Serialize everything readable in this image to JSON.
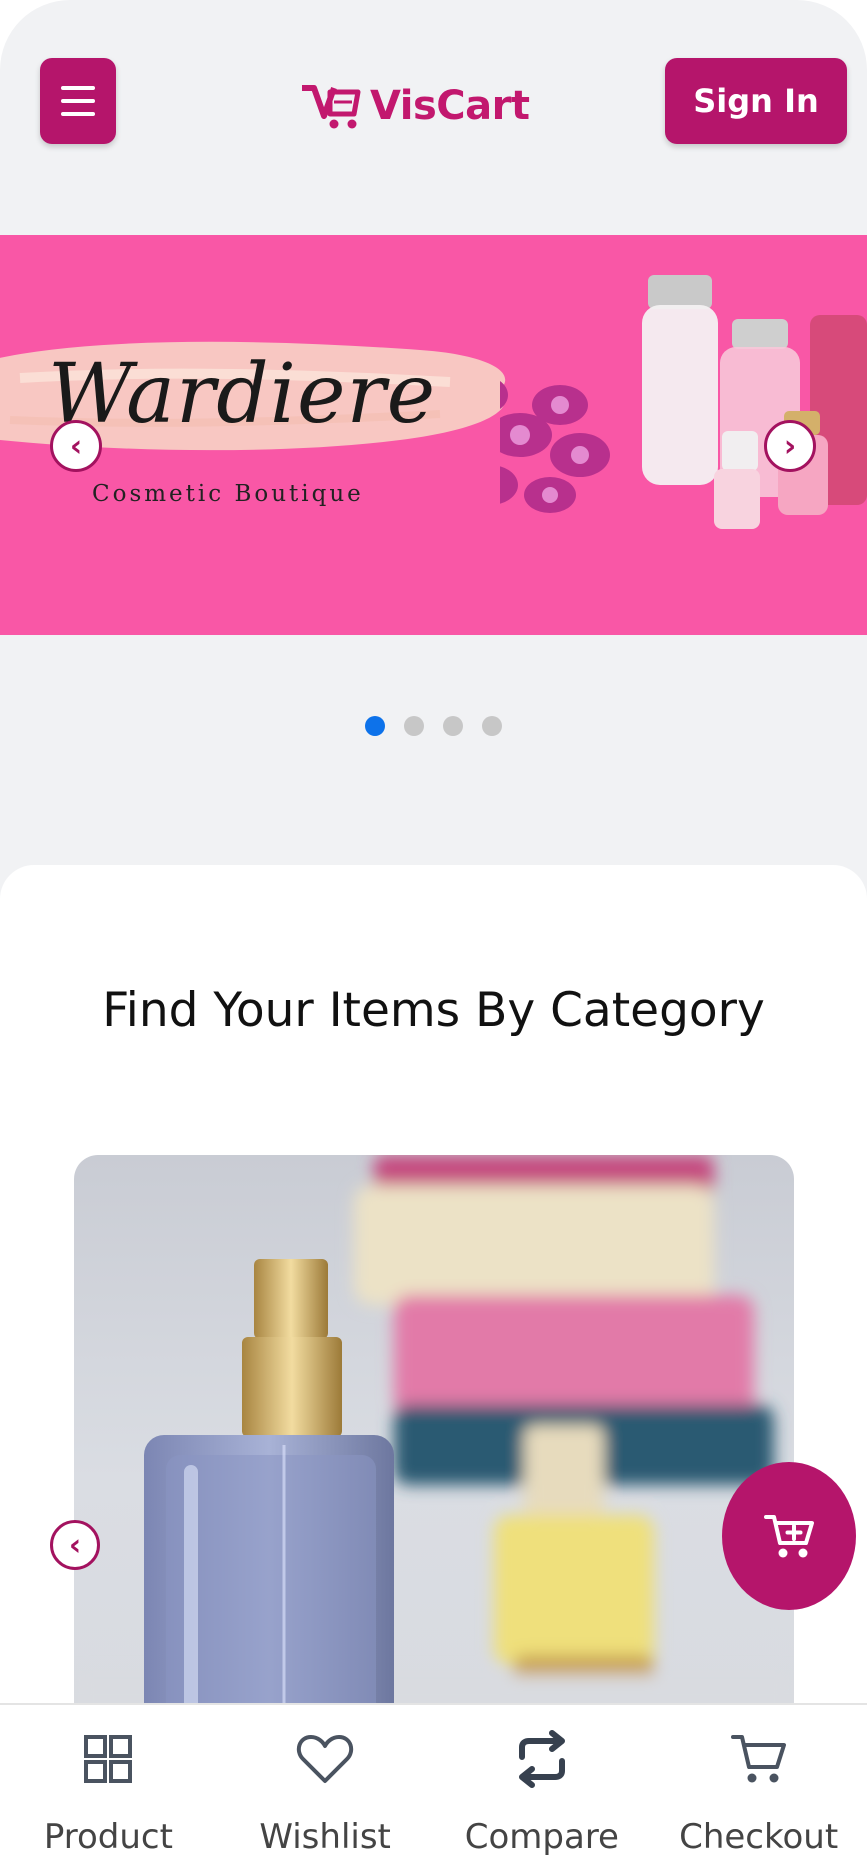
{
  "header": {
    "menu_icon": "hamburger-icon",
    "logo_text": "VisCart",
    "signin_label": "Sign In"
  },
  "banner": {
    "brand_name": "Wardiere",
    "brand_tagline": "Cosmetic Boutique",
    "background_color": "#f957a6",
    "prev_icon": "chevron-left-icon",
    "next_icon": "chevron-right-icon",
    "slide_count": 4,
    "active_slide": 1
  },
  "category": {
    "title": "Find Your Items By Category"
  },
  "fab": {
    "icon": "add-to-cart-icon"
  },
  "bottom_nav": {
    "items": [
      {
        "label": "Product",
        "icon": "grid-icon"
      },
      {
        "label": "Wishlist",
        "icon": "heart-icon"
      },
      {
        "label": "Compare",
        "icon": "swap-icon"
      },
      {
        "label": "Checkout",
        "icon": "cart-icon"
      }
    ]
  },
  "colors": {
    "brand": "#b5156b",
    "active_dot": "#0d72ea",
    "inactive_dot": "#c7c7c7"
  }
}
